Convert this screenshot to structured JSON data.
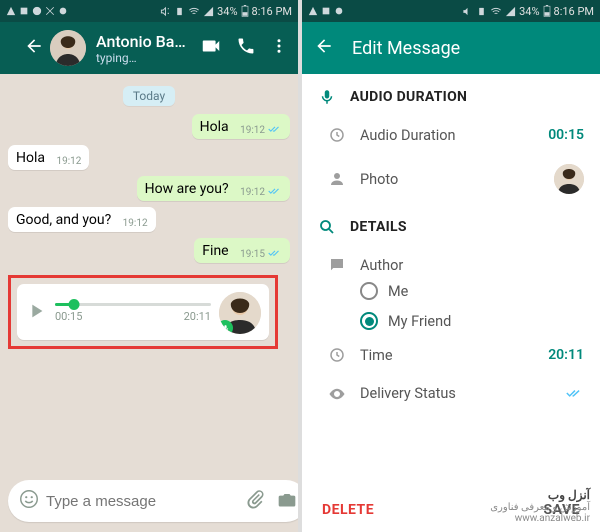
{
  "status": {
    "battery": "34%",
    "time": "8:16 PM"
  },
  "chat": {
    "contact_name": "Antonio Banderas",
    "typing": "typing…",
    "date_label": "Today",
    "messages": [
      {
        "dir": "out",
        "text": "Hola",
        "time": "19:12",
        "ticks": true
      },
      {
        "dir": "in",
        "text": "Hola",
        "time": "19:12",
        "ticks": false
      },
      {
        "dir": "out",
        "text": "How are you?",
        "time": "19:12",
        "ticks": true
      },
      {
        "dir": "in",
        "text": "Good, and you?",
        "time": "19:12",
        "ticks": false
      },
      {
        "dir": "out",
        "text": "Fine",
        "time": "19:15",
        "ticks": true
      }
    ],
    "voice": {
      "elapsed": "00:15",
      "sent_time": "20:11"
    },
    "composer_placeholder": "Type a message"
  },
  "edit": {
    "title": "Edit Message",
    "section_audio": "AUDIO DURATION",
    "audio_duration_label": "Audio Duration",
    "audio_duration_value": "00:15",
    "photo_label": "Photo",
    "section_details": "DETAILS",
    "author_label": "Author",
    "author_me": "Me",
    "author_friend": "My Friend",
    "time_label": "Time",
    "time_value": "20:11",
    "delivery_label": "Delivery Status",
    "delete": "DELETE",
    "save": "SAVE"
  },
  "watermark": {
    "brand": "آنزل وب",
    "sub": "آموزش و معرفی فناوری",
    "url": "www.anzalweb.ir"
  }
}
